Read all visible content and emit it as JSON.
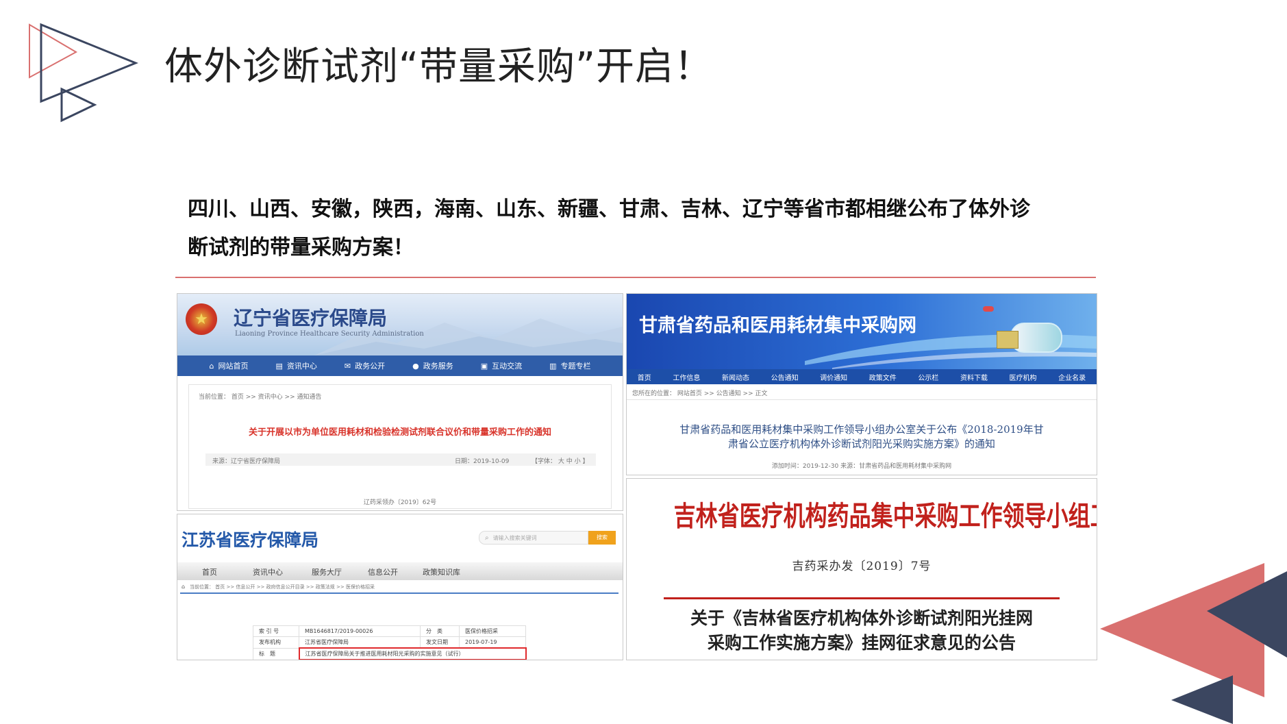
{
  "slide": {
    "title": "体外诊断试剂“带量采购”开启！",
    "intro_line1": "四川、山西、安徽，陕西，海南、山东、新疆、甘肃、吉林、辽宁等省市都相继公布了体外诊",
    "intro_line2": "断试剂的带量采购方案！",
    "accent_color": "#d9706f",
    "navy_color": "#3b4660"
  },
  "liaoning": {
    "title": "辽宁省医疗保障局",
    "subtitle": "Liaoning Province Healthcare Security Administration",
    "nav": [
      {
        "icon": "home-icon",
        "label": "网站首页"
      },
      {
        "icon": "book-icon",
        "label": "资讯中心"
      },
      {
        "icon": "envelope-icon",
        "label": "政务公开"
      },
      {
        "icon": "user-icon",
        "label": "政务服务"
      },
      {
        "icon": "chat-icon",
        "label": "互动交流"
      },
      {
        "icon": "columns-icon",
        "label": "专题专栏"
      }
    ],
    "breadcrumb": "当前位置： 首页 >> 资讯中心 >> 通知通告",
    "headline": "关于开展以市为单位医用耗材和检验检测试剂联合议价和带量采购工作的通知",
    "source": "来源：辽宁省医疗保障局",
    "date": "日期：2019-10-09",
    "font_size": "【字体： 大 中 小 】",
    "doc_no": "辽药采领办〔2019〕62号"
  },
  "gansu": {
    "title": "甘肃省药品和医用耗材集中采购网",
    "nav": [
      "首页",
      "工作信息",
      "新闻动态",
      "公告通知",
      "调价通知",
      "政策文件",
      "公示栏",
      "资料下载",
      "医疗机构",
      "企业名录"
    ],
    "breadcrumb": "您所在的位置： 网站首页 >> 公告通知 >> 正文",
    "headline_line1": "甘肃省药品和医用耗材集中采购工作领导小组办公室关于公布《2018-2019年甘",
    "headline_line2": "肃省公立医疗机构体外诊断试剂阳光采购实施方案》的通知",
    "meta": "添加时间：2019-12-30    来源：甘肃省药品和医用耗材集中采购网"
  },
  "jiangsu": {
    "title": "江苏省医疗保障局",
    "search_placeholder": "请输入搜索关键词",
    "search_button": "搜索",
    "nav": [
      "首页",
      "资讯中心",
      "服务大厅",
      "信息公开",
      "政策知识库"
    ],
    "breadcrumb": "当前位置： 首页 >> 信息公开 >> 政府信息公开目录 >> 政策法规 >> 医保价格招采",
    "meta_rows": [
      {
        "k1": "索 引 号",
        "v1": "MB1646817/2019-00026",
        "k2": "分　类",
        "v2": "医保价格招采"
      },
      {
        "k1": "发布机构",
        "v1": "江苏省医疗保障局",
        "k2": "发文日期",
        "v2": "2019-07-19"
      },
      {
        "k1": "标　题",
        "v1": "江苏省医疗保障局关于推进医用耗材阳光采购的实施意见（试行）",
        "k2": "",
        "v2": ""
      }
    ]
  },
  "jilin": {
    "title": "吉林省医疗机构药品集中采购工作领导小组工作办公室文件",
    "doc_no": "吉药采办发〔2019〕7号",
    "headline_line1": "关于《吉林省医疗机构体外诊断试剂阳光挂网",
    "headline_line2": "采购工作实施方案》挂网征求意见的公告"
  }
}
